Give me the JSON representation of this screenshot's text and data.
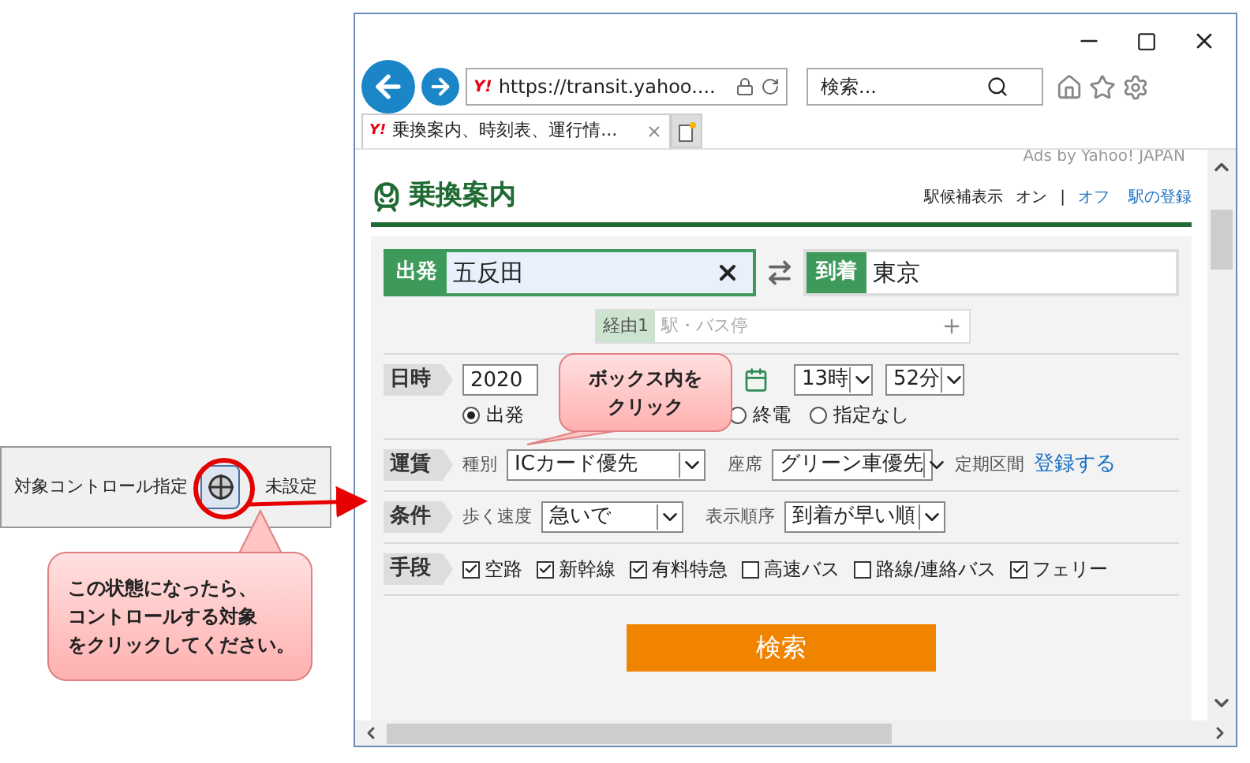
{
  "left_panel": {
    "label": "対象コントロール指定",
    "status": "未設定"
  },
  "browser": {
    "address_logo": "Y!",
    "address": "https://transit.yahoo....",
    "search_placeholder": "検索...",
    "tabs": [
      {
        "logo": "Y!",
        "title": "乗換案内、時刻表、運行情...",
        "selected": true
      }
    ],
    "ad_notice": "Ads by Yahoo! JAPAN"
  },
  "page": {
    "title": "乗換案内",
    "suggest_label": "駅候補表示",
    "suggest_options": [
      {
        "label": "オン",
        "selected": true
      },
      {
        "label": "オフ",
        "selected": false
      }
    ],
    "separator": "|",
    "register_link": "駅の登録"
  },
  "form": {
    "departure": {
      "label": "出発",
      "value": "五反田"
    },
    "arrival": {
      "label": "到着",
      "value": "東京"
    },
    "via": {
      "label": "経由1",
      "placeholder": "駅・バス停"
    },
    "datetime": {
      "label": "日時",
      "date": "2020",
      "hour": "13時",
      "minute": "52分",
      "options": [
        {
          "label": "出発",
          "selected": true
        },
        {
          "label": "終電",
          "selected": false
        },
        {
          "label": "指定なし",
          "selected": false
        }
      ]
    },
    "fare": {
      "label": "運賃",
      "type_label": "種別",
      "type_value": "ICカード優先",
      "seat_label": "座席",
      "seat_value": "グリーン車優先",
      "pass_label": "定期区間",
      "pass_link": "登録する"
    },
    "conditions": {
      "label": "条件",
      "walk_label": "歩く速度",
      "walk_value": "急いで",
      "order_label": "表示順序",
      "order_value": "到着が早い順"
    },
    "means": {
      "label": "手段",
      "items": [
        {
          "label": "空路",
          "checked": true
        },
        {
          "label": "新幹線",
          "checked": true
        },
        {
          "label": "有料特急",
          "checked": true
        },
        {
          "label": "高速バス",
          "checked": false
        },
        {
          "label": "路線/連絡バス",
          "checked": false
        },
        {
          "label": "フェリー",
          "checked": true
        }
      ]
    },
    "search_button": "検索"
  },
  "callouts": [
    {
      "lines": [
        "ボックス内を",
        "クリック"
      ]
    },
    {
      "lines": [
        "この状態になったら、",
        "コントロールする対象",
        "をクリックしてください。"
      ]
    }
  ]
}
